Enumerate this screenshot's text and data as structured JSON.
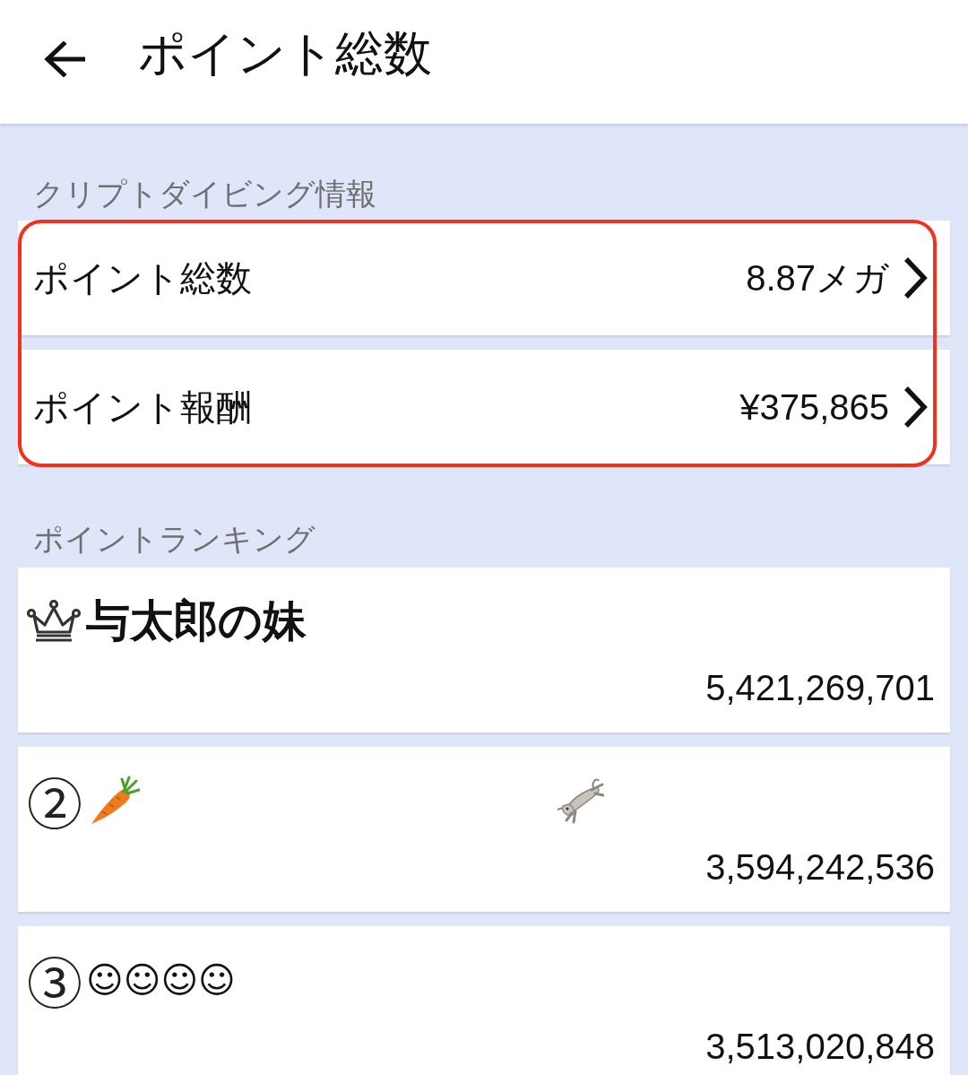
{
  "header": {
    "title": "ポイント総数"
  },
  "info_section": {
    "label": "クリプトダイビング情報",
    "highlighted": true,
    "rows": [
      {
        "label": "ポイント総数",
        "value": "8.87メガ"
      },
      {
        "label": "ポイント報酬",
        "value": "¥375,865"
      }
    ]
  },
  "ranking_section": {
    "label": "ポイントランキング",
    "entries": [
      {
        "kind": "crown",
        "name": "与太郎の妹",
        "score": "5,421,269,701"
      },
      {
        "kind": "number",
        "rank": "②",
        "emoji": [
          {
            "kind": "carrot"
          },
          {
            "kind": "goat"
          }
        ],
        "score": "3,594,242,536"
      },
      {
        "kind": "number",
        "rank": "③",
        "name": "☺☺☺☺",
        "score": "3,513,020,848"
      }
    ]
  }
}
